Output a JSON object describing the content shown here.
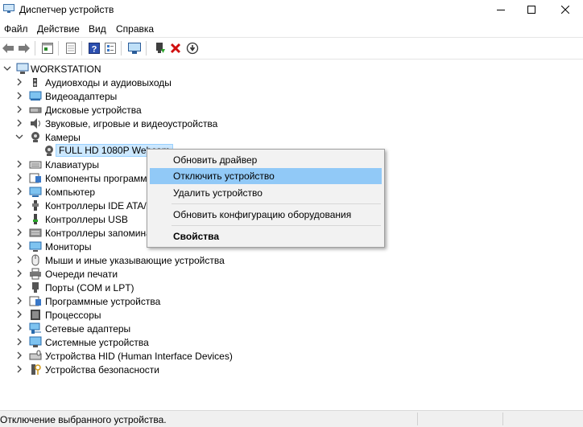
{
  "window": {
    "title": "Диспетчер устройств"
  },
  "menu": [
    "Файл",
    "Действие",
    "Вид",
    "Справка"
  ],
  "toolbar": [
    {
      "icon": "back-arrow-icon"
    },
    {
      "icon": "forward-arrow-icon"
    },
    {
      "icon": "properties-icon"
    },
    {
      "icon": "sheet-icon"
    },
    {
      "icon": "help-icon"
    },
    {
      "icon": "device-view-icon"
    },
    {
      "icon": "monitor-scan-icon"
    },
    {
      "icon": "update-driver-icon"
    },
    {
      "icon": "uninstall-x-icon"
    },
    {
      "icon": "disable-device-icon"
    }
  ],
  "tree": {
    "root": "WORKSTATION",
    "items": [
      {
        "label": "Аудиовходы и аудиовыходы",
        "icon": "audio-icon"
      },
      {
        "label": "Видеоадаптеры",
        "icon": "display-adapter-icon"
      },
      {
        "label": "Дисковые устройства",
        "icon": "disk-drive-icon"
      },
      {
        "label": "Звуковые, игровые и видеоустройства",
        "icon": "sound-icon"
      },
      {
        "label": "Камеры",
        "icon": "camera-icon",
        "expanded": true,
        "children": [
          {
            "label": "FULL HD 1080P Webcam",
            "icon": "webcam-icon"
          }
        ]
      },
      {
        "label": "Клавиатуры",
        "icon": "keyboard-icon"
      },
      {
        "label": "Компоненты программ",
        "icon": "software-component-icon"
      },
      {
        "label": "Компьютер",
        "icon": "computer-icon"
      },
      {
        "label": "Контроллеры IDE ATA/AT",
        "icon": "ide-controller-icon"
      },
      {
        "label": "Контроллеры USB",
        "icon": "usb-icon"
      },
      {
        "label": "Контроллеры запомина",
        "icon": "storage-controller-icon"
      },
      {
        "label": "Мониторы",
        "icon": "monitor-icon"
      },
      {
        "label": "Мыши и иные указывающие устройства",
        "icon": "mouse-icon"
      },
      {
        "label": "Очереди печати",
        "icon": "printer-icon"
      },
      {
        "label": "Порты (COM и LPT)",
        "icon": "port-icon"
      },
      {
        "label": "Программные устройства",
        "icon": "software-device-icon"
      },
      {
        "label": "Процессоры",
        "icon": "processor-icon"
      },
      {
        "label": "Сетевые адаптеры",
        "icon": "network-icon"
      },
      {
        "label": "Системные устройства",
        "icon": "system-icon"
      },
      {
        "label": "Устройства HID (Human Interface Devices)",
        "icon": "hid-icon"
      },
      {
        "label": "Устройства безопасности",
        "icon": "security-icon"
      }
    ]
  },
  "context_menu": {
    "items": [
      "Обновить драйвер",
      "Отключить устройство",
      "Удалить устройство",
      "Обновить конфигурацию оборудования",
      "Свойства"
    ],
    "highlighted": "Отключить устройство"
  },
  "status": {
    "text": "Отключение выбранного устройства."
  }
}
